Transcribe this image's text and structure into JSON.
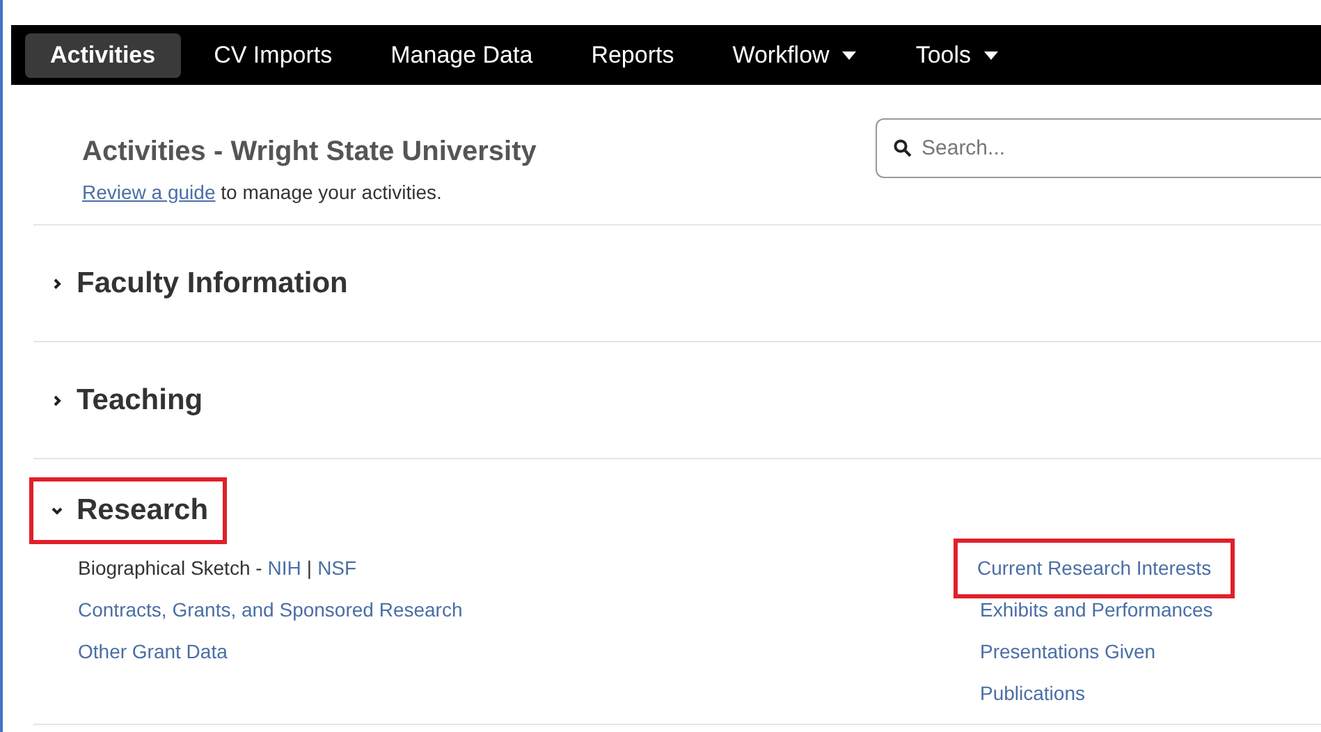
{
  "nav": {
    "items": [
      {
        "label": "Activities",
        "selected": true,
        "dropdown": false
      },
      {
        "label": "CV Imports",
        "selected": false,
        "dropdown": false
      },
      {
        "label": "Manage Data",
        "selected": false,
        "dropdown": false
      },
      {
        "label": "Reports",
        "selected": false,
        "dropdown": false
      },
      {
        "label": "Workflow",
        "selected": false,
        "dropdown": true
      },
      {
        "label": "Tools",
        "selected": false,
        "dropdown": true
      }
    ]
  },
  "header": {
    "title": "Activities - Wright State University",
    "guide_link": "Review a guide",
    "guide_text": "to manage your activities."
  },
  "search": {
    "placeholder": "Search..."
  },
  "sections": [
    {
      "title": "Faculty Information",
      "expanded": false,
      "highlighted": false
    },
    {
      "title": "Teaching",
      "expanded": false,
      "highlighted": false
    },
    {
      "title": "Research",
      "expanded": true,
      "highlighted": true,
      "columns": [
        [
          {
            "kind": "multi",
            "label": "Biographical Sketch -",
            "links": [
              "NIH",
              "NSF"
            ],
            "separator": "|"
          },
          {
            "kind": "link",
            "label": "Contracts, Grants, and Sponsored Research",
            "highlighted": false
          },
          {
            "kind": "link",
            "label": "Other Grant Data",
            "highlighted": false
          }
        ],
        [
          {
            "kind": "link",
            "label": "Current Research Interests",
            "highlighted": true
          },
          {
            "kind": "link",
            "label": "Exhibits and Performances",
            "highlighted": false
          },
          {
            "kind": "link",
            "label": "Presentations Given",
            "highlighted": false
          },
          {
            "kind": "link",
            "label": "Publications",
            "highlighted": false
          }
        ]
      ]
    }
  ]
}
